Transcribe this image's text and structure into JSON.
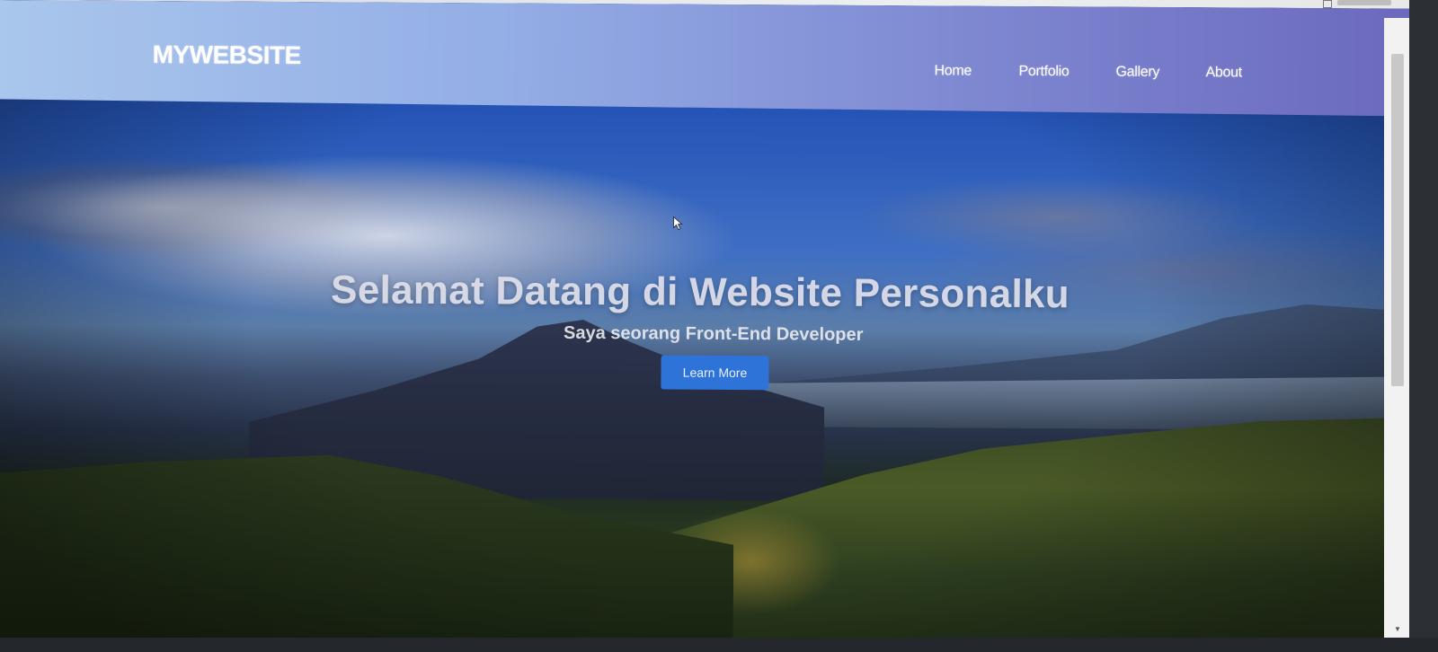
{
  "navbar": {
    "brand": "MYWEBSITE",
    "links": [
      "Home",
      "Portfolio",
      "Gallery",
      "About"
    ]
  },
  "hero": {
    "title": "Selamat Datang di Website Personalku",
    "subtitle": "Saya seorang Front-End Developer",
    "button_label": "Learn More"
  },
  "colors": {
    "navbar_start": "#a9c6ec",
    "navbar_end": "#6b68bd",
    "button": "#2e73d8"
  },
  "icons": {
    "cursor": "mouse-pointer-icon",
    "scroll_down": "chevron-down-icon"
  }
}
